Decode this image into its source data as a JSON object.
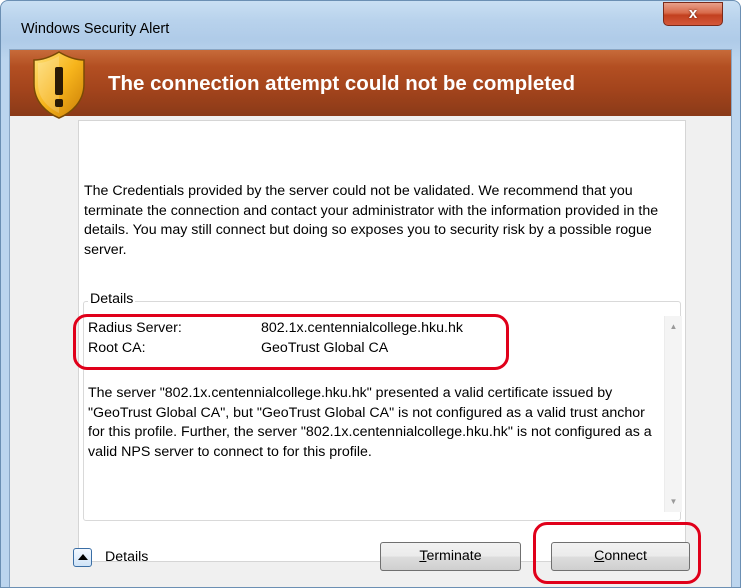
{
  "window": {
    "title": "Windows Security Alert",
    "close_glyph": "x"
  },
  "banner": {
    "heading": "The connection attempt could not be completed",
    "icon": "shield-warning-icon"
  },
  "message": "The Credentials provided by the server could not be validated. We recommend that you terminate the connection and contact your administrator with the information provided in the details. You may still connect but doing so exposes you to security risk by a possible rogue server.",
  "details": {
    "legend": "Details",
    "rows": [
      {
        "key": "Radius Server:",
        "value": "802.1x.centennialcollege.hku.hk"
      },
      {
        "key": "Root CA:",
        "value": "GeoTrust Global CA"
      }
    ],
    "description": "The server \"802.1x.centennialcollege.hku.hk\" presented a valid certificate issued by \"GeoTrust Global CA\", but \"GeoTrust Global CA\" is not configured as a valid trust anchor for this profile. Further, the server \"802.1x.centennialcollege.hku.hk\" is not configured as a valid NPS server to connect to for this profile."
  },
  "footer": {
    "details_toggle": "Details",
    "terminate": {
      "first": "T",
      "rest": "erminate"
    },
    "connect": {
      "first": "C",
      "rest": "onnect"
    }
  },
  "colors": {
    "banner": "#a3441c",
    "annotation": "#e0001a",
    "close_button": "#c2401f"
  }
}
